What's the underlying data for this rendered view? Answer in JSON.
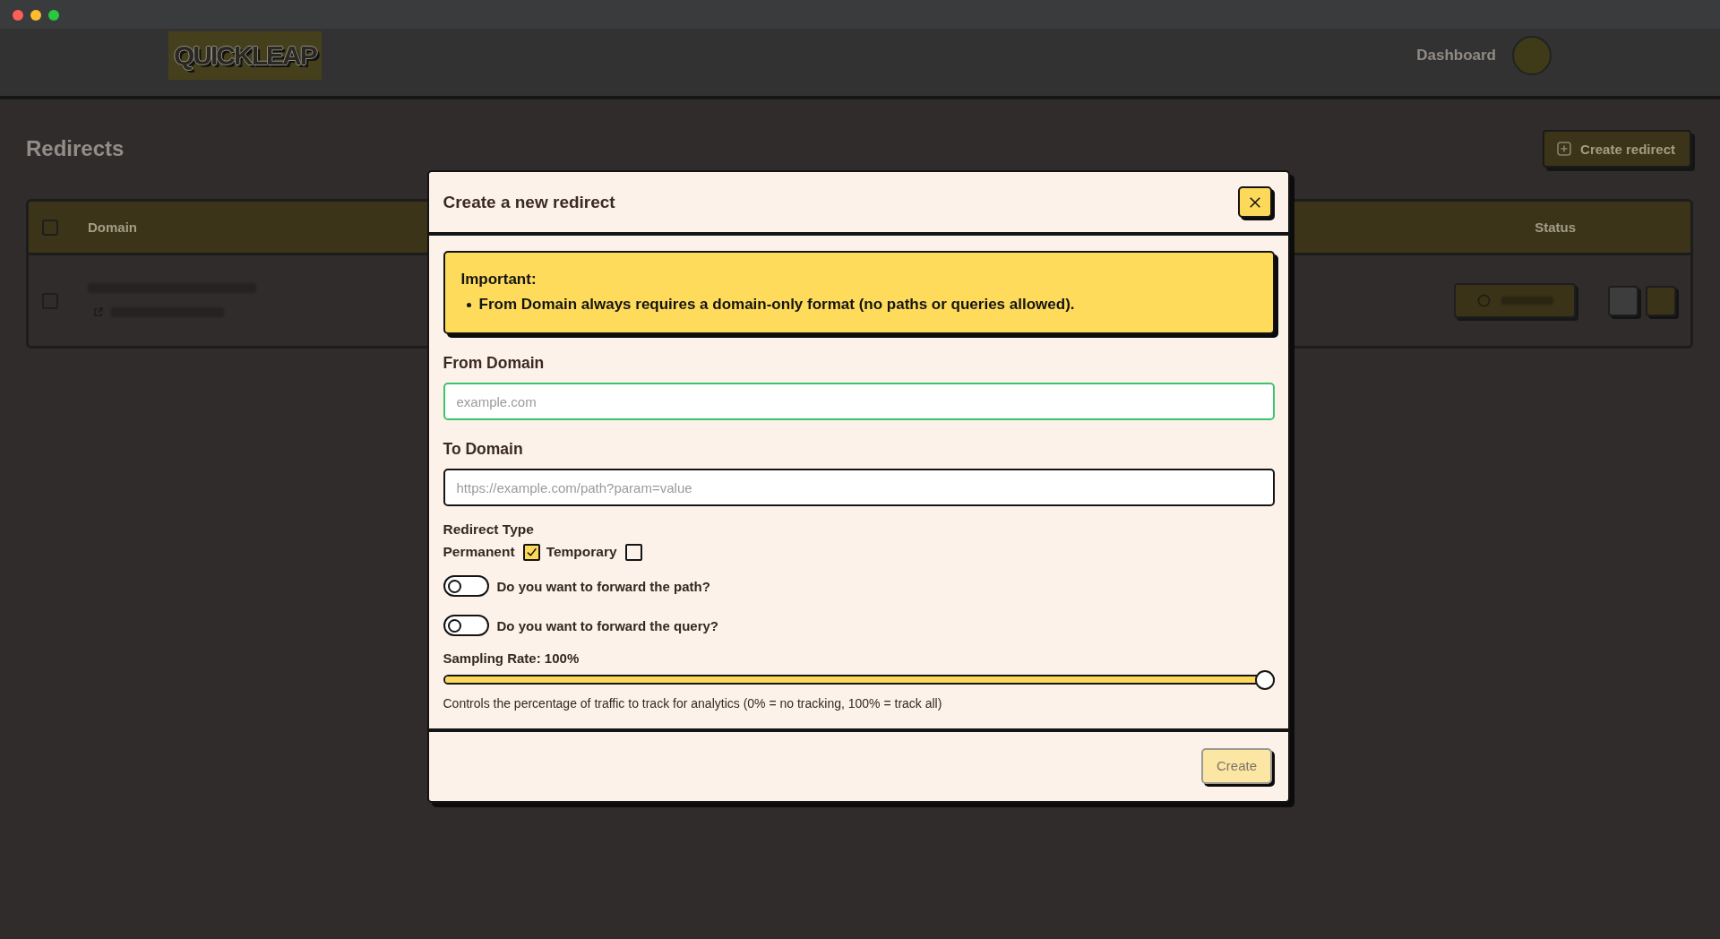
{
  "header": {
    "logo": "QUICKLEAP",
    "nav": [
      "Dashboard"
    ]
  },
  "page": {
    "title": "Redirects",
    "action": "Create redirect"
  },
  "table": {
    "select_all": {
      "checked": false
    },
    "columns": [
      "Domain",
      "Status"
    ],
    "rows": [
      {
        "checked": false
      }
    ]
  },
  "dialog": {
    "title": "Create a new redirect",
    "notice": {
      "heading": "Important:",
      "items": [
        "From Domain always requires a domain-only format (no paths or queries allowed)."
      ]
    },
    "fields": [
      {
        "label": "From Domain",
        "placeholder": "example.com",
        "focused": true
      },
      {
        "label": "To Domain",
        "placeholder": "https://example.com/path?param=value",
        "focused": false
      }
    ],
    "redirect_type": {
      "label": "Redirect Type",
      "options": [
        {
          "label": "Permanent",
          "checked": true
        },
        {
          "label": "Temporary",
          "checked": false
        }
      ]
    },
    "toggles": [
      {
        "label": "Do you want to forward the path?",
        "on": false
      },
      {
        "label": "Do you want to forward the query?",
        "on": false
      }
    ],
    "sampling": {
      "label": "Sampling Rate: 100%",
      "level": 1,
      "help": "Controls the percentage of traffic to track for analytics (0% = no tracking, 100% = track all)"
    },
    "buttons": [
      {
        "label": "Create",
        "disabled": true
      }
    ]
  }
}
